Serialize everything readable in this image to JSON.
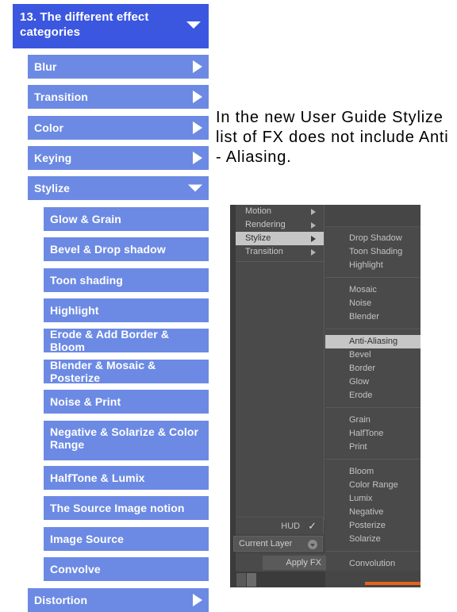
{
  "toc": {
    "heading": "13. The different effect categories",
    "heading_icon": "chevron-down-icon",
    "level1": [
      {
        "label": "Blur",
        "icon": "chevron-right-icon",
        "expanded": false
      },
      {
        "label": "Transition",
        "icon": "chevron-right-icon",
        "expanded": false
      },
      {
        "label": "Color",
        "icon": "chevron-right-icon",
        "expanded": false
      },
      {
        "label": "Keying",
        "icon": "chevron-right-icon",
        "expanded": false
      },
      {
        "label": "Stylize",
        "icon": "chevron-down-icon",
        "expanded": true
      },
      {
        "label": "Distortion",
        "icon": "chevron-right-icon",
        "expanded": false
      }
    ],
    "stylize_children": [
      "Glow & Grain",
      "Bevel & Drop shadow",
      "Toon shading",
      "Highlight",
      "Erode & Add Border & Bloom",
      "Blender & Mosaic & Posterize",
      "Noise & Print",
      "Negative & Solarize & Color Range",
      "HalfTone & Lumix",
      "The Source Image notion",
      "Image Source",
      "Convolve"
    ],
    "colors": {
      "header": "#3b57e0",
      "item": "#6c8ae4",
      "text": "#ffffff"
    }
  },
  "note": {
    "text": "In the new User Guide Stylize list of FX does not include Anti - Aliasing."
  },
  "app": {
    "menu": {
      "items": [
        {
          "label": "Motion",
          "selected": false,
          "icon": "arrow-right-icon"
        },
        {
          "label": "Rendering",
          "selected": false,
          "icon": "arrow-right-icon"
        },
        {
          "label": "Stylize",
          "selected": true,
          "icon": "arrow-right-icon"
        },
        {
          "label": "Transition",
          "selected": false,
          "icon": "arrow-right-icon"
        }
      ]
    },
    "submenu": {
      "groups": [
        {
          "items": [
            {
              "label": "Drop Shadow",
              "selected": false
            },
            {
              "label": "Toon Shading",
              "selected": false
            },
            {
              "label": "Highlight",
              "selected": false
            }
          ]
        },
        {
          "items": [
            {
              "label": "Mosaic",
              "selected": false
            },
            {
              "label": "Noise",
              "selected": false
            },
            {
              "label": "Blender",
              "selected": false
            }
          ]
        },
        {
          "items": [
            {
              "label": "Anti-Aliasing",
              "selected": true
            },
            {
              "label": "Bevel",
              "selected": false
            },
            {
              "label": "Border",
              "selected": false
            },
            {
              "label": "Glow",
              "selected": false
            },
            {
              "label": "Erode",
              "selected": false
            }
          ]
        },
        {
          "items": [
            {
              "label": "Grain",
              "selected": false
            },
            {
              "label": "HalfTone",
              "selected": false
            },
            {
              "label": "Print",
              "selected": false
            }
          ]
        },
        {
          "items": [
            {
              "label": "Bloom",
              "selected": false
            },
            {
              "label": "Color Range",
              "selected": false
            },
            {
              "label": "Lumix",
              "selected": false
            },
            {
              "label": "Negative",
              "selected": false
            },
            {
              "label": "Posterize",
              "selected": false
            },
            {
              "label": "Solarize",
              "selected": false
            }
          ]
        },
        {
          "items": [
            {
              "label": "Convolution",
              "selected": false
            }
          ]
        }
      ]
    },
    "controls": {
      "hud_label": "HUD",
      "hud_check": "✓",
      "layer_value": "Current Layer",
      "layer_icon": "combo-dropdown-icon",
      "apply_label": "Apply FX"
    },
    "colors": {
      "panel": "#464646",
      "menu": "#4a4a4a",
      "selected": "#c6c6c6",
      "accent": "#e8621a"
    }
  }
}
